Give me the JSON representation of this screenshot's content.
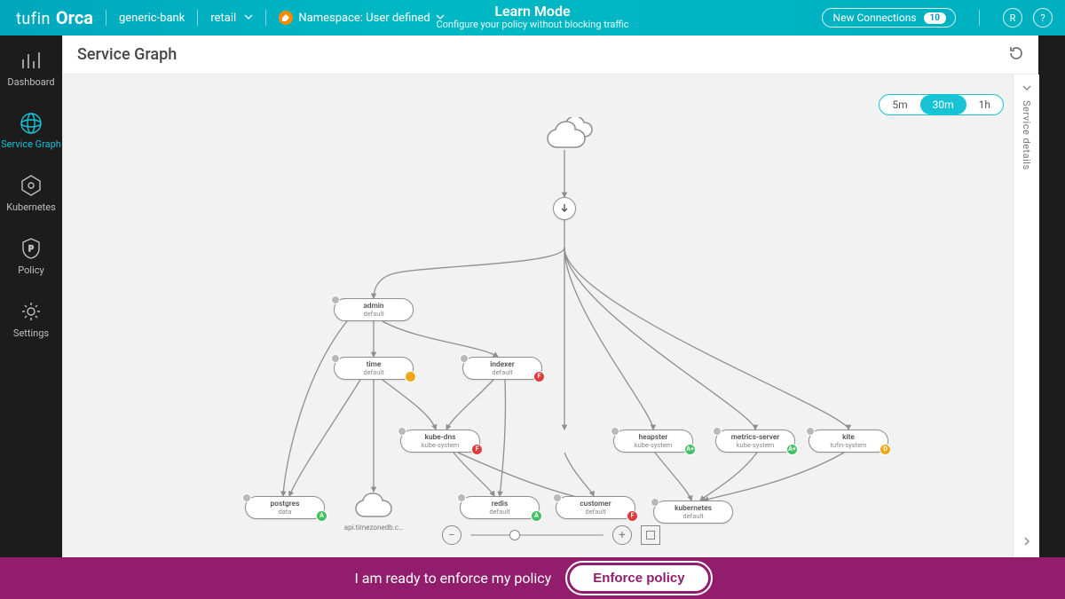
{
  "brand": {
    "tufin": "tufin",
    "orca": "Orca"
  },
  "context": {
    "org": "generic-bank",
    "env": "retail",
    "ns_label": "Namespace: User defined"
  },
  "learn": {
    "title": "Learn Mode",
    "subtitle": "Configure your policy without blocking traffic"
  },
  "top_actions": {
    "new_conn_label": "New Connections",
    "new_conn_count": "10",
    "user_initial": "R",
    "help": "?"
  },
  "sidebar": {
    "items": [
      {
        "label": "Dashboard"
      },
      {
        "label": "Service Graph"
      },
      {
        "label": "Kubernetes"
      },
      {
        "label": "Policy"
      },
      {
        "label": "Settings"
      }
    ],
    "active_index": 1
  },
  "page": {
    "title": "Service Graph"
  },
  "time_range": {
    "options": [
      "5m",
      "30m",
      "1h"
    ],
    "selected": "30m"
  },
  "drawer": {
    "title": "Service details"
  },
  "nodes": {
    "admin": {
      "name": "admin",
      "ns": "default"
    },
    "time": {
      "name": "time",
      "ns": "default"
    },
    "indexer": {
      "name": "indexer",
      "ns": "default"
    },
    "kubedns": {
      "name": "kube-dns",
      "ns": "kube-system"
    },
    "heapster": {
      "name": "heapster",
      "ns": "kube-system"
    },
    "metrics": {
      "name": "metrics-server",
      "ns": "kube-system"
    },
    "kite": {
      "name": "kite",
      "ns": "tufin-system"
    },
    "postgres": {
      "name": "postgres",
      "ns": "data"
    },
    "redis": {
      "name": "redis",
      "ns": "default"
    },
    "customer": {
      "name": "customer",
      "ns": "default"
    },
    "kubernetes": {
      "name": "kubernetes",
      "ns": "default"
    },
    "ext_api": {
      "label": "api.timezonedb.c…"
    }
  },
  "grades": {
    "postgres": "A",
    "time": "",
    "indexer": "F",
    "kubedns": "F",
    "heapster": "A+",
    "metrics": "A+",
    "kite": "D",
    "redis": "A",
    "customer": "F"
  },
  "footer": {
    "msg": "I am ready to enforce my policy",
    "btn": "Enforce policy"
  }
}
